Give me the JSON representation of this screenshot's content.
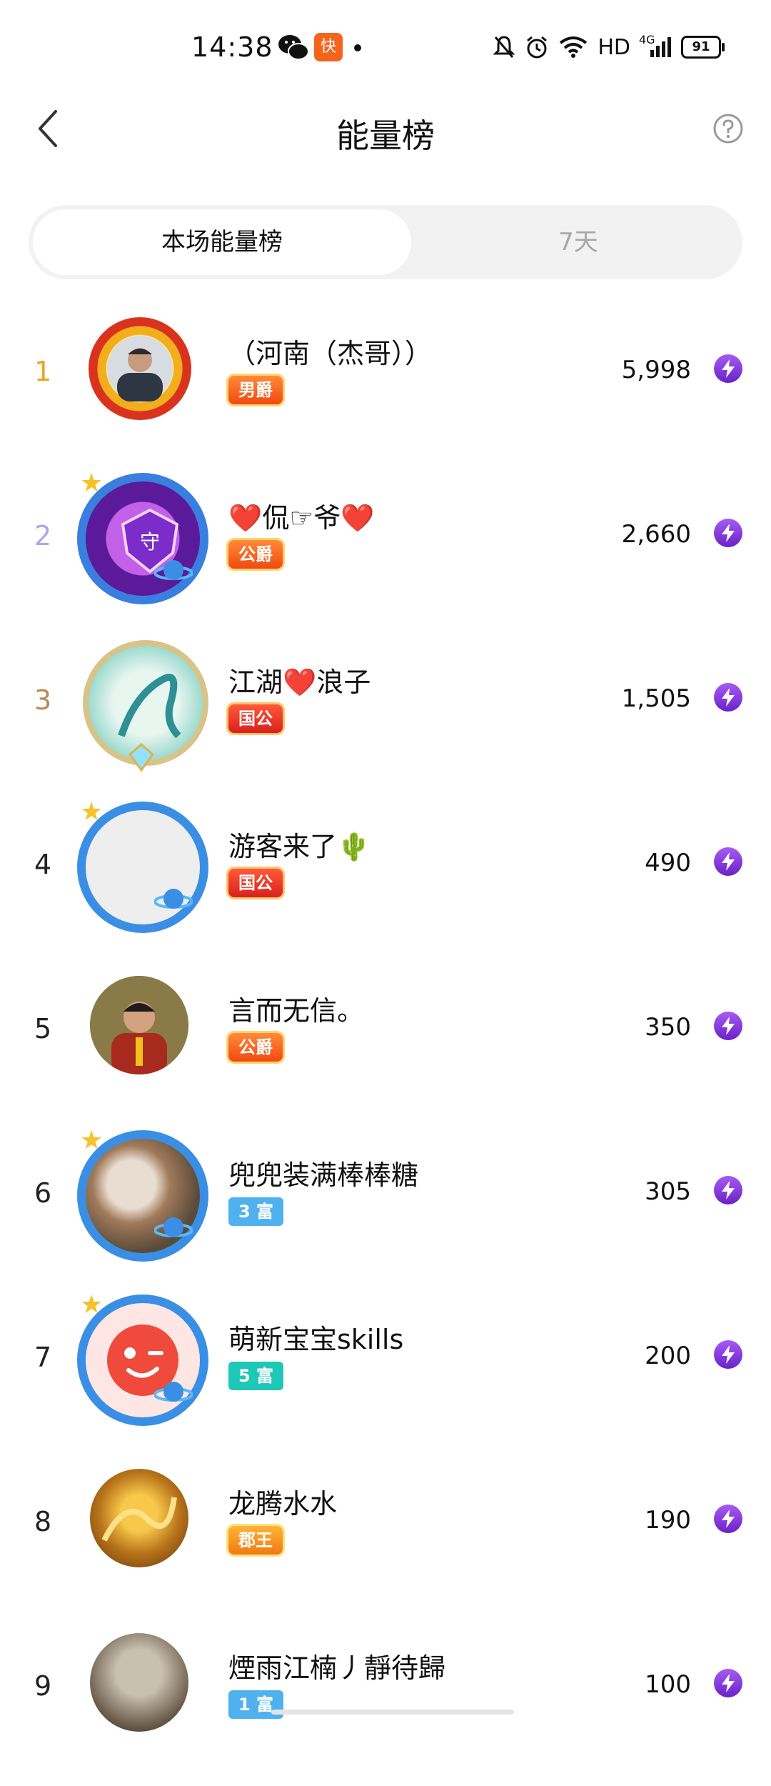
{
  "status_bar": {
    "time": "14:38",
    "app_badge": "快",
    "network": "HD",
    "signal": "4G",
    "battery": "91",
    "icons": [
      "wechat-icon",
      "kuaishou-icon",
      "mute-icon",
      "alarm-icon",
      "wifi-icon",
      "signal-icon",
      "battery-icon"
    ]
  },
  "header": {
    "title": "能量榜",
    "back_icon": "chevron-left-icon",
    "help_icon": "help-circle-icon"
  },
  "tabs": [
    {
      "label": "本场能量榜",
      "active": true
    },
    {
      "label": "7天",
      "active": false
    }
  ],
  "rank_colors": {
    "1": "#e6a71c",
    "2": "#a7a8e8",
    "3": "#b98a5a",
    "default": "#222222"
  },
  "accent": "#8a3ce0",
  "rows": [
    {
      "rank": "1",
      "name": "（河南（杰哥））",
      "badge": "男爵",
      "badge_type": "noble",
      "score": "5,998"
    },
    {
      "rank": "2",
      "name": "❤️侃☞爷❤️",
      "badge": "公爵",
      "badge_type": "noble",
      "score": "2,660"
    },
    {
      "rank": "3",
      "name": "江湖❤️浪子",
      "badge": "国公",
      "badge_type": "guo",
      "score": "1,505"
    },
    {
      "rank": "4",
      "name": "游客来了🌵",
      "badge": "国公",
      "badge_type": "guo",
      "score": "490"
    },
    {
      "rank": "5",
      "name": "言而无信。",
      "badge": "公爵",
      "badge_type": "noble",
      "score": "350"
    },
    {
      "rank": "6",
      "name": "兜兜装满棒棒糖",
      "badge": "3 富",
      "badge_type": "fu-blue",
      "score": "305"
    },
    {
      "rank": "7",
      "name": "萌新宝宝skills",
      "badge": "5 富",
      "badge_type": "fu-teal",
      "score": "200"
    },
    {
      "rank": "8",
      "name": "龙腾水水",
      "badge": "郡王",
      "badge_type": "wang",
      "score": "190"
    },
    {
      "rank": "9",
      "name": "煙雨江楠丿靜待歸",
      "badge": "1 富",
      "badge_type": "fu-blue",
      "score": "100"
    }
  ]
}
